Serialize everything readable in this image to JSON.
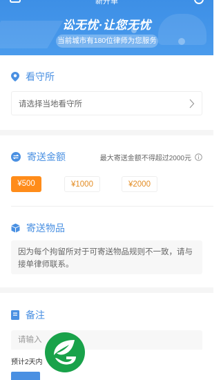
{
  "header": {
    "nav_title": "新开单",
    "slogan": "讼无忧·让您无忧",
    "lawyer_notice": "当前城市有180位律师为您服务"
  },
  "detention": {
    "title": "看守所",
    "placeholder": "请选择当地看守所"
  },
  "amount": {
    "title": "寄送金额",
    "note": "最大寄送金额不得超过2000元",
    "options": [
      "¥500",
      "¥1000",
      "¥2000"
    ],
    "selected": "¥500"
  },
  "items": {
    "title": "寄送物品",
    "notice": "因为每个拘留所对于可寄送物品规则不一致，请与接单律师联系。"
  },
  "remark": {
    "title": "备注",
    "placeholder": "请输入"
  },
  "footer": {
    "estimate": "预计2天内"
  },
  "colors": {
    "primary": "#4a90e2",
    "accent": "#ff8c1a",
    "banner": "#3d8fe6",
    "logo_green": "#19a24a"
  }
}
